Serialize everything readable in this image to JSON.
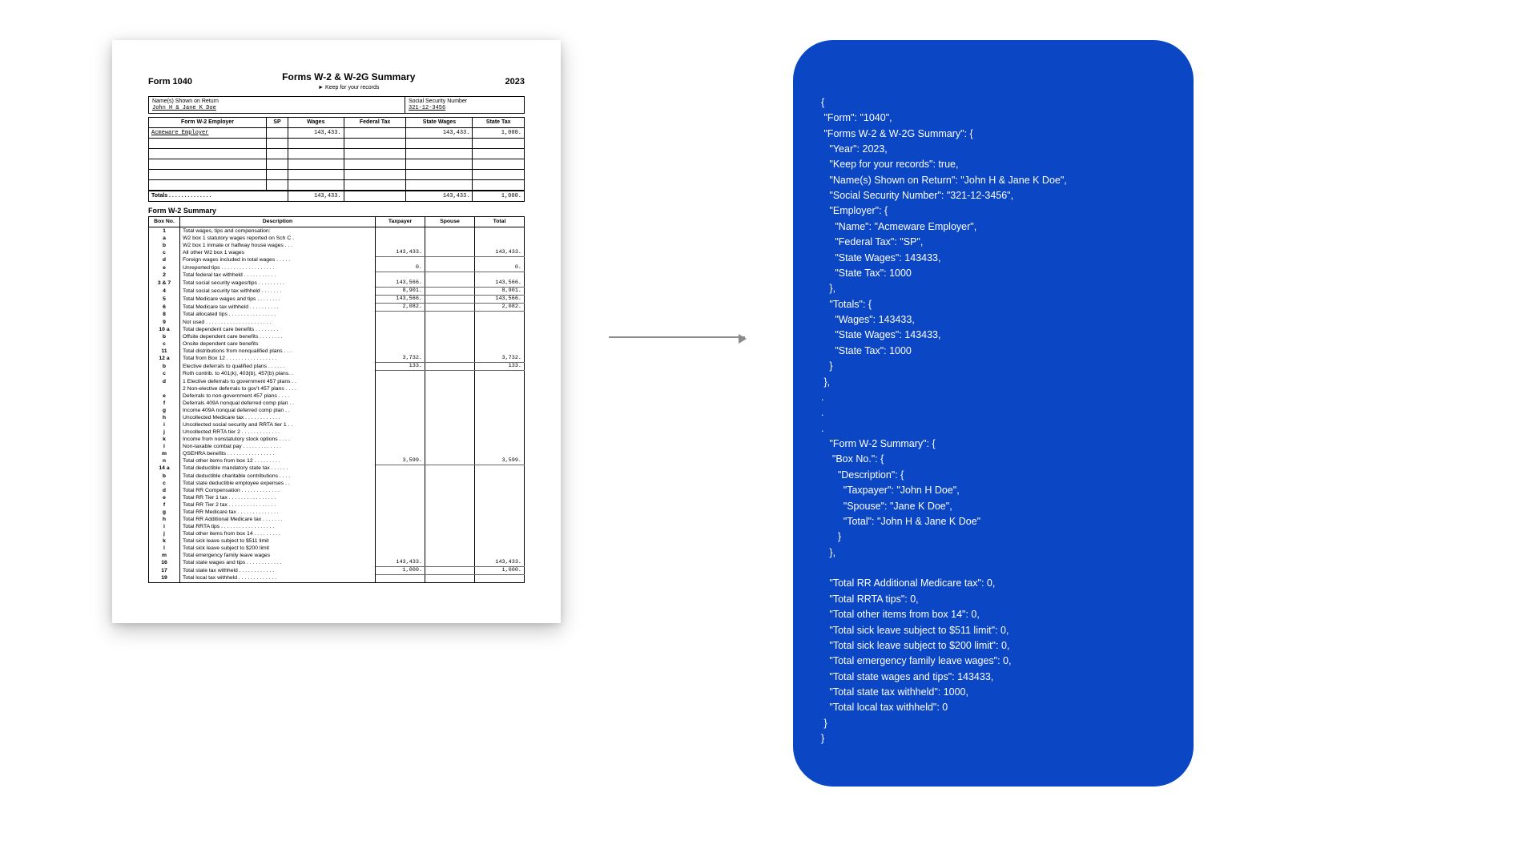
{
  "header": {
    "form": "Form 1040",
    "title": "Forms W-2 & W-2G Summary",
    "sub": "► Keep for your records",
    "year": "2023",
    "nameLabel": "Name(s) Shown on Return",
    "name": "John H & Jane K Doe",
    "ssnLabel": "Social Security Number",
    "ssn": "321-12-3456"
  },
  "w2grid": {
    "cols": [
      "Form W-2   Employer",
      "SP",
      "Wages",
      "Federal Tax",
      "State Wages",
      "State Tax"
    ],
    "row1": {
      "emp": "Acmeware Employer",
      "sp": "",
      "wages": "143,433.",
      "fed": "",
      "sw": "143,433.",
      "st": "1,000."
    },
    "totalsLabel": "Totals . . . . . . . . . . . . . .",
    "tot": {
      "wages": "143,433.",
      "fed": "",
      "sw": "143,433.",
      "st": "1,000."
    }
  },
  "summary": {
    "title": "Form W-2 Summary",
    "cols": [
      "Box No.",
      "Description",
      "Taxpayer",
      "Spouse",
      "Total"
    ],
    "rows": [
      {
        "n": "1",
        "d": "Total wages, tips and compensation:"
      },
      {
        "n": "a",
        "d": "W2 box 1 statutory wages reported on Sch C  ."
      },
      {
        "n": "b",
        "d": "W2 box 1 inmate or halfway house wages . . ."
      },
      {
        "n": "c",
        "d": "All other W2 box 1 wages",
        "t": "143,433.",
        "s": "",
        "tot": "143,433."
      },
      {
        "n": "d",
        "d": "Foreign wages included in total wages . . . . ."
      },
      {
        "n": "e",
        "d": "Unreported tips . . . . . . . . . . . . . . . . . .",
        "t": "0.",
        "s": "",
        "tot": "0."
      },
      {
        "n": "2",
        "d": "Total federal tax withheld  . . . . . . . . . . ."
      },
      {
        "n": "3 & 7",
        "d": "Total social security wages/tips . . . . . . . . .",
        "t": "143,566.",
        "s": "",
        "tot": "143,566."
      },
      {
        "n": "4",
        "d": "Total social security tax withheld . . . . . . .",
        "t": "8,901.",
        "s": "",
        "tot": "8,901."
      },
      {
        "n": "5",
        "d": "Total Medicare wages and tips  . . . . . . . .",
        "t": "143,566.",
        "s": "",
        "tot": "143,566."
      },
      {
        "n": "6",
        "d": "Total Medicare tax withheld . . . . . . . . . .",
        "t": "2,082.",
        "s": "",
        "tot": "2,082."
      },
      {
        "n": "8",
        "d": "Total allocated tips . . . . . . . . . . . . . . . ."
      },
      {
        "n": "9",
        "d": "Not used . . . . . . . . . . . . . . . . . . . . . ."
      },
      {
        "n": "10 a",
        "d": "Total dependent care benefits  . . . . . . . ."
      },
      {
        "n": "b",
        "d": "Offsite dependent care benefits . . . . . . . ."
      },
      {
        "n": "c",
        "d": "Onsite dependent care benefits"
      },
      {
        "n": "11",
        "d": "Total distributions from nonqualified plans . . ."
      },
      {
        "n": "12 a",
        "d": "Total from Box 12 . . . . . . . . . . . . . . . . .",
        "t": "3,732.",
        "s": "",
        "tot": "3,732."
      },
      {
        "n": "b",
        "d": "Elective deferrals to qualified plans . . . . . .",
        "t": "133.",
        "s": "",
        "tot": "133."
      },
      {
        "n": "c",
        "d": "Roth contrib. to 401(k), 403(b), 457(b) plans. ."
      },
      {
        "n": "d",
        "d": "1 Elective deferrals to government 457 plans  . ."
      },
      {
        "n": "",
        "d": "2 Non-elective deferrals to gov't 457 plans . . . ."
      },
      {
        "n": "e",
        "d": "Deferrals to non-government 457 plans . . . ."
      },
      {
        "n": "f",
        "d": "Deferrals 409A nonqual deferred comp plan . ."
      },
      {
        "n": "g",
        "d": "Income 409A nonqual deferred comp plan . ."
      },
      {
        "n": "h",
        "d": "Uncollected Medicare tax . . . . . . . . . . . ."
      },
      {
        "n": "i",
        "d": "Uncollected social security and RRTA tier 1 . ."
      },
      {
        "n": "j",
        "d": "Uncollected RRTA tier 2 . . . . . . . . . . . . ."
      },
      {
        "n": "k",
        "d": "Income from nonstatutory stock options . . . ."
      },
      {
        "n": "l",
        "d": "Non-taxable combat pay . . . . . . . . . . . . ."
      },
      {
        "n": "m",
        "d": "QSEHRA benefits  . . . . . . . . . . . . . . . ."
      },
      {
        "n": "n",
        "d": "Total other items from box 12 . . . . . . . . .",
        "t": "3,599.",
        "s": "",
        "tot": "3,599."
      },
      {
        "n": "14 a",
        "d": "Total deductible mandatory state tax . . . . . ."
      },
      {
        "n": "b",
        "d": "Total deductible charitable contributions . . . ."
      },
      {
        "n": "c",
        "d": "Total state deductible employee expenses . ."
      },
      {
        "n": "d",
        "d": "Total RR Compensation . . . . . . . . . . . . ."
      },
      {
        "n": "e",
        "d": "Total RR Tier 1 tax . . . . . . . . . . . . . . . ."
      },
      {
        "n": "f",
        "d": "Total RR Tier 2 tax . . . . . . . . . . . . . . . ."
      },
      {
        "n": "g",
        "d": "Total RR Medicare tax . . . . . . . . . . . . . ."
      },
      {
        "n": "h",
        "d": "Total RR Additional Medicare tax . . . . . . ."
      },
      {
        "n": "i",
        "d": "Total RRTA tips . . . . . . . . . . . . . . . . . ."
      },
      {
        "n": "j",
        "d": "Total other items from box 14 . . . . . . . . ."
      },
      {
        "n": "k",
        "d": "Total sick leave subject to $511 limit"
      },
      {
        "n": "l",
        "d": "Total sick leave subject to $200 limit"
      },
      {
        "n": "m",
        "d": "Total emergency family leave wages"
      },
      {
        "n": "16",
        "d": "Total state wages and tips . . . . . . . . . . . .",
        "t": "143,433.",
        "s": "",
        "tot": "143,433."
      },
      {
        "n": "17",
        "d": "Total state tax withheld  . . . . . . . . . . . .",
        "t": "1,000.",
        "s": "",
        "tot": "1,000."
      },
      {
        "n": "19",
        "d": "Total local tax withheld . . . . . . . . . . . . ."
      }
    ]
  },
  "json_output": "{\n \"Form\": \"1040\",\n \"Forms W-2 & W-2G Summary\": {\n   \"Year\": 2023,\n   \"Keep for your records\": true,\n   \"Name(s) Shown on Return\": \"John H & Jane K Doe\",\n   \"Social Security Number\": \"321-12-3456\",\n   \"Employer\": {\n     \"Name\": \"Acmeware Employer\",\n     \"Federal Tax\": \"SP\",\n     \"State Wages\": 143433,\n     \"State Tax\": 1000\n   },\n   \"Totals\": {\n     \"Wages\": 143433,\n     \"State Wages\": 143433,\n     \"State Tax\": 1000\n   }\n },\n.\n.\n.\n   \"Form W-2 Summary\": {\n    \"Box No.\": {\n      \"Description\": {\n        \"Taxpayer\": \"John H Doe\",\n        \"Spouse\": \"Jane K Doe\",\n        \"Total\": \"John H & Jane K Doe\"\n      }\n   },\n\n   \"Total RR Additional Medicare tax\": 0,\n   \"Total RRTA tips\": 0,\n   \"Total other items from box 14\": 0,\n   \"Total sick leave subject to $511 limit\": 0,\n   \"Total sick leave subject to $200 limit\": 0,\n   \"Total emergency family leave wages\": 0,\n   \"Total state wages and tips\": 143433,\n   \"Total state tax withheld\": 1000,\n   \"Total local tax withheld\": 0\n }\n}"
}
